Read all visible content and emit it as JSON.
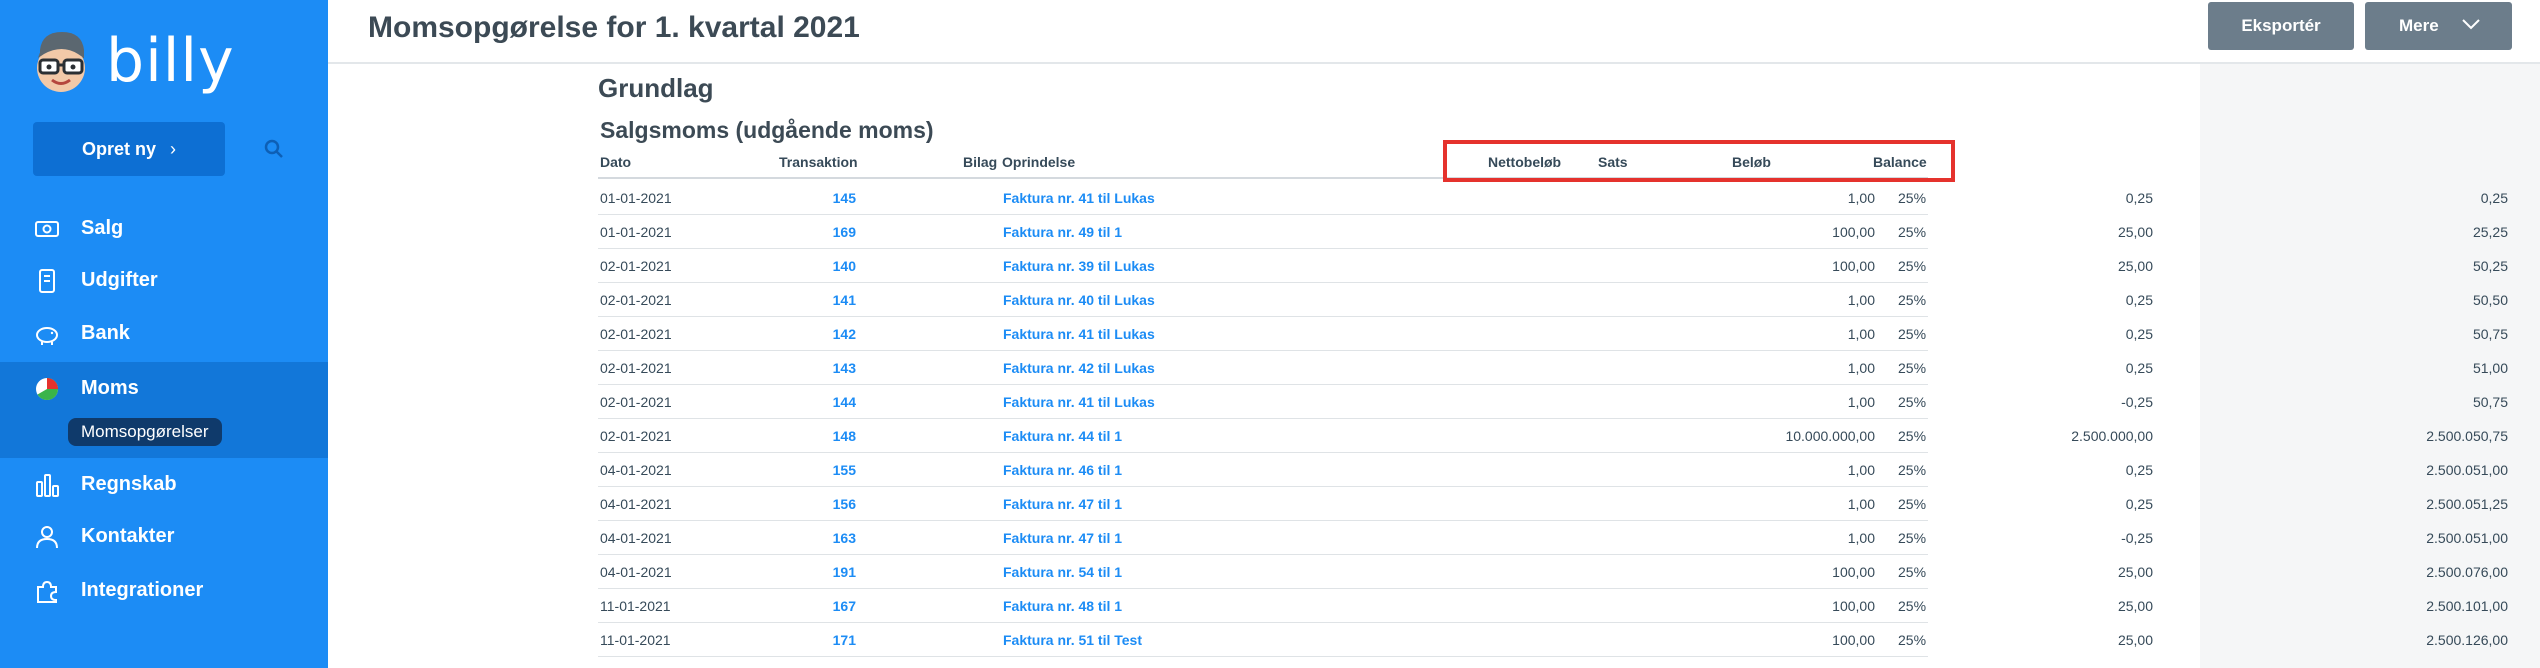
{
  "app": {
    "brand": "billy",
    "create_label": "Opret ny",
    "nav": [
      {
        "label": "Salg",
        "icon": "banknote-icon"
      },
      {
        "label": "Udgifter",
        "icon": "receipt-icon"
      },
      {
        "label": "Bank",
        "icon": "piggy-bank-icon"
      },
      {
        "label": "Moms",
        "icon": "pie-chart-icon"
      },
      {
        "label": "Regnskab",
        "icon": "bar-chart-icon"
      },
      {
        "label": "Kontakter",
        "icon": "person-icon"
      },
      {
        "label": "Integrationer",
        "icon": "puzzle-icon"
      }
    ],
    "subnav_active": "Momsopgørelser"
  },
  "header": {
    "title": "Momsopgørelse for 1. kvartal 2021",
    "export_label": "Eksportér",
    "more_label": "Mere"
  },
  "report": {
    "section_title": "Grundlag",
    "subsection_title": "Salgsmoms (udgående moms)",
    "columns": {
      "date": "Dato",
      "transaction": "Transaktion",
      "voucher": "Bilag",
      "origin": "Oprindelse",
      "net": "Nettobeløb",
      "rate": "Sats",
      "amount": "Beløb",
      "balance": "Balance"
    },
    "rows": [
      {
        "date": "01-01-2021",
        "trans": "145",
        "origin": "Faktura nr. 41 til Lukas",
        "net": "1,00",
        "rate": "25%",
        "amount": "0,25",
        "balance": "0,25"
      },
      {
        "date": "01-01-2021",
        "trans": "169",
        "origin": "Faktura nr. 49 til 1",
        "net": "100,00",
        "rate": "25%",
        "amount": "25,00",
        "balance": "25,25"
      },
      {
        "date": "02-01-2021",
        "trans": "140",
        "origin": "Faktura nr. 39 til Lukas",
        "net": "100,00",
        "rate": "25%",
        "amount": "25,00",
        "balance": "50,25"
      },
      {
        "date": "02-01-2021",
        "trans": "141",
        "origin": "Faktura nr. 40 til Lukas",
        "net": "1,00",
        "rate": "25%",
        "amount": "0,25",
        "balance": "50,50"
      },
      {
        "date": "02-01-2021",
        "trans": "142",
        "origin": "Faktura nr. 41 til Lukas",
        "net": "1,00",
        "rate": "25%",
        "amount": "0,25",
        "balance": "50,75"
      },
      {
        "date": "02-01-2021",
        "trans": "143",
        "origin": "Faktura nr. 42 til Lukas",
        "net": "1,00",
        "rate": "25%",
        "amount": "0,25",
        "balance": "51,00"
      },
      {
        "date": "02-01-2021",
        "trans": "144",
        "origin": "Faktura nr. 41 til Lukas",
        "net": "1,00",
        "rate": "25%",
        "amount": "-0,25",
        "balance": "50,75"
      },
      {
        "date": "02-01-2021",
        "trans": "148",
        "origin": "Faktura nr. 44 til 1",
        "net": "10.000.000,00",
        "rate": "25%",
        "amount": "2.500.000,00",
        "balance": "2.500.050,75"
      },
      {
        "date": "04-01-2021",
        "trans": "155",
        "origin": "Faktura nr. 46 til 1",
        "net": "1,00",
        "rate": "25%",
        "amount": "0,25",
        "balance": "2.500.051,00"
      },
      {
        "date": "04-01-2021",
        "trans": "156",
        "origin": "Faktura nr. 47 til 1",
        "net": "1,00",
        "rate": "25%",
        "amount": "0,25",
        "balance": "2.500.051,25"
      },
      {
        "date": "04-01-2021",
        "trans": "163",
        "origin": "Faktura nr. 47 til 1",
        "net": "1,00",
        "rate": "25%",
        "amount": "-0,25",
        "balance": "2.500.051,00"
      },
      {
        "date": "04-01-2021",
        "trans": "191",
        "origin": "Faktura nr. 54 til 1",
        "net": "100,00",
        "rate": "25%",
        "amount": "25,00",
        "balance": "2.500.076,00"
      },
      {
        "date": "11-01-2021",
        "trans": "167",
        "origin": "Faktura nr. 48 til 1",
        "net": "100,00",
        "rate": "25%",
        "amount": "25,00",
        "balance": "2.500.101,00"
      },
      {
        "date": "11-01-2021",
        "trans": "171",
        "origin": "Faktura nr. 51 til Test",
        "net": "100,00",
        "rate": "25%",
        "amount": "25,00",
        "balance": "2.500.126,00"
      }
    ]
  },
  "colors": {
    "sidebar": "#1c8cf5",
    "sidebar_active": "#1277d9",
    "link": "#1c8cf5",
    "button": "#6c7d8b",
    "highlight": "#e5322d"
  }
}
